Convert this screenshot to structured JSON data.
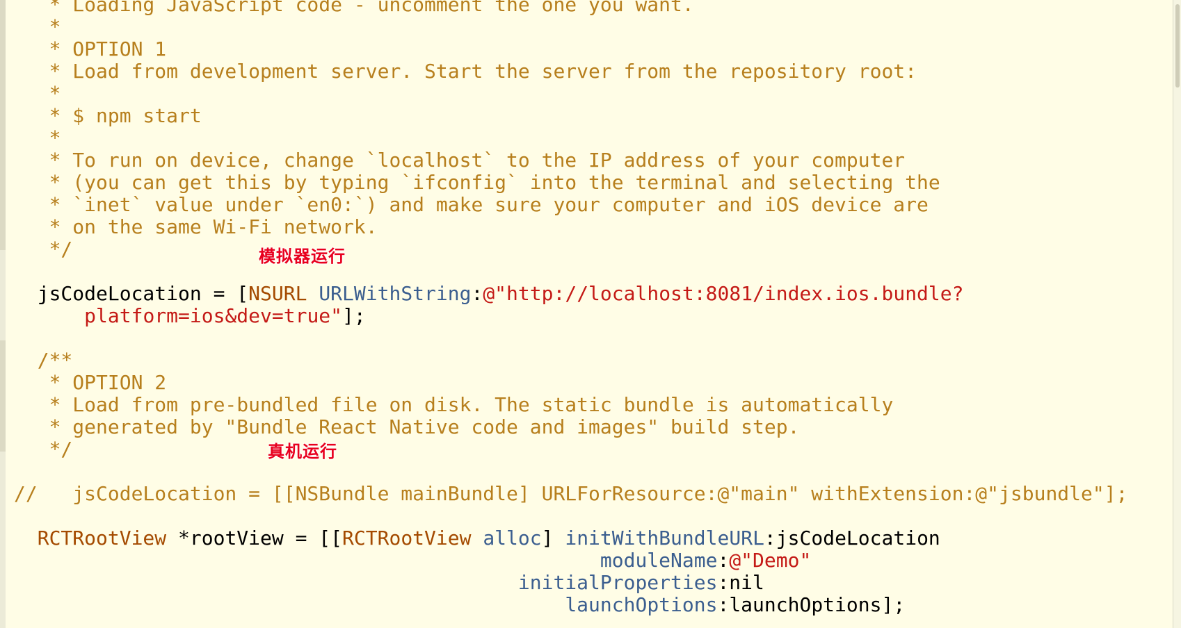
{
  "editor": {
    "lines": [
      [
        {
          "t": "   * Loading JavaScript code - uncomment the one you want.",
          "c": "cm"
        }
      ],
      [
        {
          "t": "   *",
          "c": "cm"
        }
      ],
      [
        {
          "t": "   * OPTION 1",
          "c": "cm"
        }
      ],
      [
        {
          "t": "   * Load from development server. Start the server from the repository root:",
          "c": "cm"
        }
      ],
      [
        {
          "t": "   *",
          "c": "cm"
        }
      ],
      [
        {
          "t": "   * $ npm start",
          "c": "cm"
        }
      ],
      [
        {
          "t": "   *",
          "c": "cm"
        }
      ],
      [
        {
          "t": "   * To run on device, change `localhost` to the IP address of your computer",
          "c": "cm"
        }
      ],
      [
        {
          "t": "   * (you can get this by typing `ifconfig` into the terminal and selecting the",
          "c": "cm"
        }
      ],
      [
        {
          "t": "   * `inet` value under `en0:`) and make sure your computer and iOS device are",
          "c": "cm"
        }
      ],
      [
        {
          "t": "   * on the same Wi-Fi network.",
          "c": "cm"
        }
      ],
      [
        {
          "t": "   */",
          "c": "cm"
        }
      ],
      [
        {
          "t": "",
          "c": "plain"
        }
      ],
      [
        {
          "t": "  jsCodeLocation = [",
          "c": "plain"
        },
        {
          "t": "NSURL",
          "c": "cls"
        },
        {
          "t": " ",
          "c": "plain"
        },
        {
          "t": "URLWithString",
          "c": "mth"
        },
        {
          "t": ":",
          "c": "plain"
        },
        {
          "t": "@\"http://localhost:8081/index.ios.bundle?",
          "c": "str"
        }
      ],
      [
        {
          "t": "      ",
          "c": "plain"
        },
        {
          "t": "platform=ios&dev=true\"",
          "c": "str"
        },
        {
          "t": "];",
          "c": "plain"
        }
      ],
      [
        {
          "t": "",
          "c": "plain"
        }
      ],
      [
        {
          "t": "  /**",
          "c": "cm"
        }
      ],
      [
        {
          "t": "   * OPTION 2",
          "c": "cm"
        }
      ],
      [
        {
          "t": "   * Load from pre-bundled file on disk. The static bundle is automatically",
          "c": "cm"
        }
      ],
      [
        {
          "t": "   * generated by \"Bundle React Native code and images\" build step.",
          "c": "cm"
        }
      ],
      [
        {
          "t": "   */",
          "c": "cm"
        }
      ],
      [
        {
          "t": "",
          "c": "plain"
        }
      ],
      [
        {
          "t": "//   jsCodeLocation = [[NSBundle mainBundle] URLForResource:@\"main\" withExtension:@\"jsbundle\"];",
          "c": "cm"
        }
      ],
      [
        {
          "t": "",
          "c": "plain"
        }
      ],
      [
        {
          "t": "  ",
          "c": "plain"
        },
        {
          "t": "RCTRootView",
          "c": "cls"
        },
        {
          "t": " *rootView = [[",
          "c": "plain"
        },
        {
          "t": "RCTRootView",
          "c": "cls"
        },
        {
          "t": " ",
          "c": "plain"
        },
        {
          "t": "alloc",
          "c": "mth"
        },
        {
          "t": "] ",
          "c": "plain"
        },
        {
          "t": "initWithBundleURL",
          "c": "mth"
        },
        {
          "t": ":jsCodeLocation",
          "c": "plain"
        }
      ],
      [
        {
          "t": "                                                  ",
          "c": "plain"
        },
        {
          "t": "moduleName",
          "c": "mth"
        },
        {
          "t": ":",
          "c": "plain"
        },
        {
          "t": "@\"Demo\"",
          "c": "str"
        }
      ],
      [
        {
          "t": "                                           ",
          "c": "plain"
        },
        {
          "t": "initialProperties",
          "c": "mth"
        },
        {
          "t": ":nil",
          "c": "plain"
        }
      ],
      [
        {
          "t": "                                               ",
          "c": "plain"
        },
        {
          "t": "launchOptions",
          "c": "mth"
        },
        {
          "t": ":launchOptions];",
          "c": "plain"
        }
      ]
    ]
  },
  "annotations": {
    "simulator": "模拟器运行",
    "device": "真机运行"
  },
  "colors": {
    "background": "#fffde6",
    "comment": "#b77f1d",
    "string": "#c41a16",
    "class": "#a44a00",
    "method": "#3b5e8f",
    "annotation": "#e8001e"
  }
}
